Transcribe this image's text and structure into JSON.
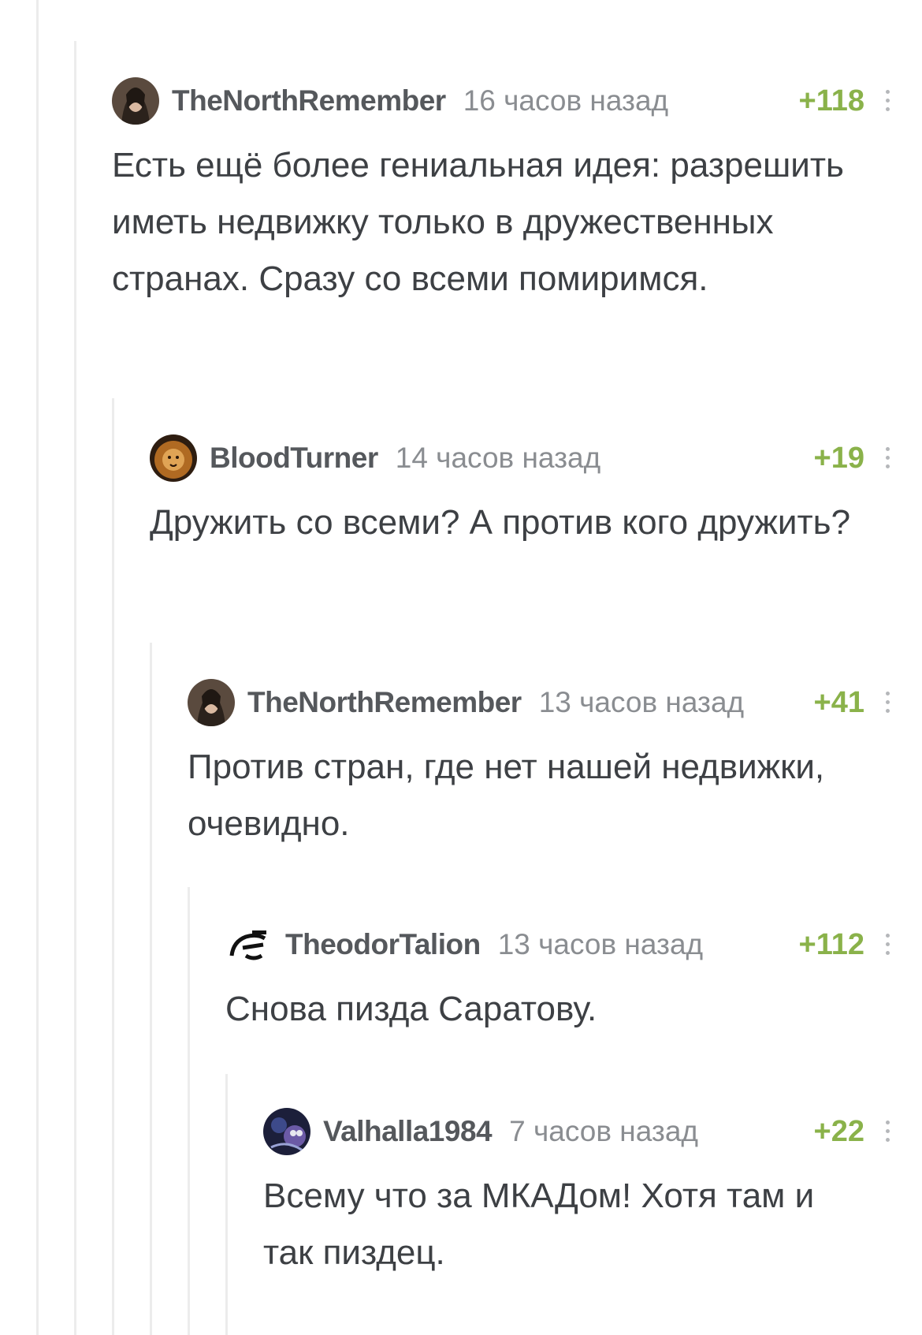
{
  "comments": [
    {
      "username": "TheNorthRemember",
      "time": "16 часов назад",
      "rating": "+118",
      "text": "Есть ещё более гениальная идея: разрешить иметь недвижку только в дружественных странах. Сразу со всеми помиримся."
    },
    {
      "username": "BloodTurner",
      "time": "14 часов назад",
      "rating": "+19",
      "text": "Дружить со всеми? А против кого дружить?"
    },
    {
      "username": "TheNorthRemember",
      "time": "13 часов назад",
      "rating": "+41",
      "text": "Против стран, где нет нашей недвижки, очевидно."
    },
    {
      "username": "TheodorTalion",
      "time": "13 часов назад",
      "rating": "+112",
      "text": "Снова пизда Саратову."
    },
    {
      "username": "Valhalla1984",
      "time": "7 часов назад",
      "rating": "+22",
      "text": "Всему что за МКАДом! Хотя там и так пиздец."
    }
  ],
  "icons": {
    "more": "vertical-dots-icon",
    "rating_color": "#8ab24a"
  }
}
